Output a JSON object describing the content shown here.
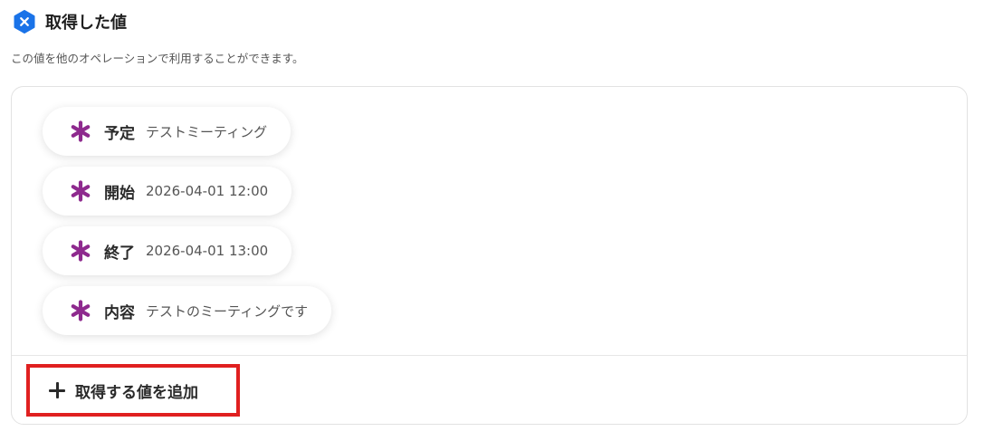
{
  "header": {
    "icon": "x-hexagon-icon",
    "title": "取得した値",
    "subtitle": "この値を他のオペレーションで利用することができます。"
  },
  "fields": [
    {
      "icon": "asterisk-icon",
      "label": "予定",
      "value": "テストミーティング"
    },
    {
      "icon": "asterisk-icon",
      "label": "開始",
      "value": "2026-04-01 12:00"
    },
    {
      "icon": "asterisk-icon",
      "label": "終了",
      "value": "2026-04-01 13:00"
    },
    {
      "icon": "asterisk-icon",
      "label": "内容",
      "value": "テストのミーティングです"
    }
  ],
  "actions": {
    "add_label": "取得する値を追加"
  },
  "colors": {
    "brand": "#1a73e8",
    "asterisk": "#8e2a8e",
    "highlight_border": "#e02020"
  }
}
